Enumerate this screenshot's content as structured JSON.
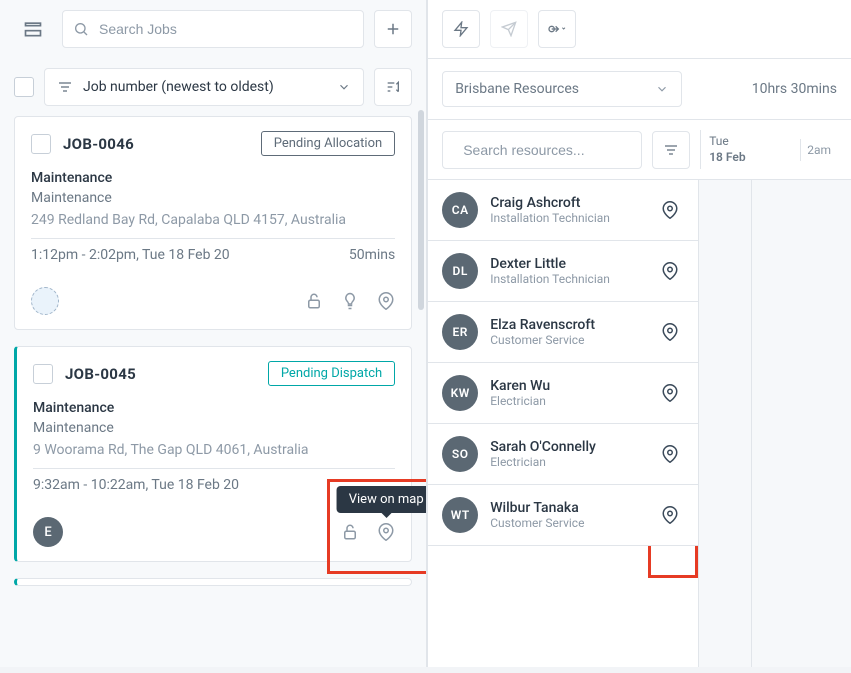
{
  "left": {
    "search_placeholder": "Search Jobs",
    "sort_label": "Job number (newest to oldest)"
  },
  "jobs": [
    {
      "id": "JOB-0046",
      "status": "Pending Allocation",
      "status_style": "gray",
      "category": "Maintenance",
      "subtype": "Maintenance",
      "address": "249 Redland Bay Rd, Capalaba QLD 4157, Australia",
      "time": "1:12pm - 2:02pm, Tue 18 Feb 20",
      "duration": "50mins",
      "assigned_initial": ""
    },
    {
      "id": "JOB-0045",
      "status": "Pending Dispatch",
      "status_style": "teal",
      "category": "Maintenance",
      "subtype": "Maintenance",
      "address": "9 Woorama Rd, The Gap QLD 4061, Australia",
      "time": "9:32am - 10:22am, Tue 18 Feb 20",
      "duration": "",
      "assigned_initial": "E"
    }
  ],
  "tooltip": {
    "view_on_map": "View on map"
  },
  "right": {
    "resource_group": "Brisbane Resources",
    "hours_summary": "10hrs 30mins",
    "search_placeholder": "Search resources...",
    "date_day": "Tue",
    "date_date": "18 Feb",
    "time_tick": "2am"
  },
  "resources": [
    {
      "initials": "CA",
      "name": "Craig Ashcroft",
      "role": "Installation Technician"
    },
    {
      "initials": "DL",
      "name": "Dexter Little",
      "role": "Installation Technician"
    },
    {
      "initials": "ER",
      "name": "Elza Ravenscroft",
      "role": "Customer Service"
    },
    {
      "initials": "KW",
      "name": "Karen Wu",
      "role": "Electrician"
    },
    {
      "initials": "SO",
      "name": "Sarah O'Connelly",
      "role": "Electrician"
    },
    {
      "initials": "WT",
      "name": "Wilbur Tanaka",
      "role": "Customer Service"
    }
  ]
}
